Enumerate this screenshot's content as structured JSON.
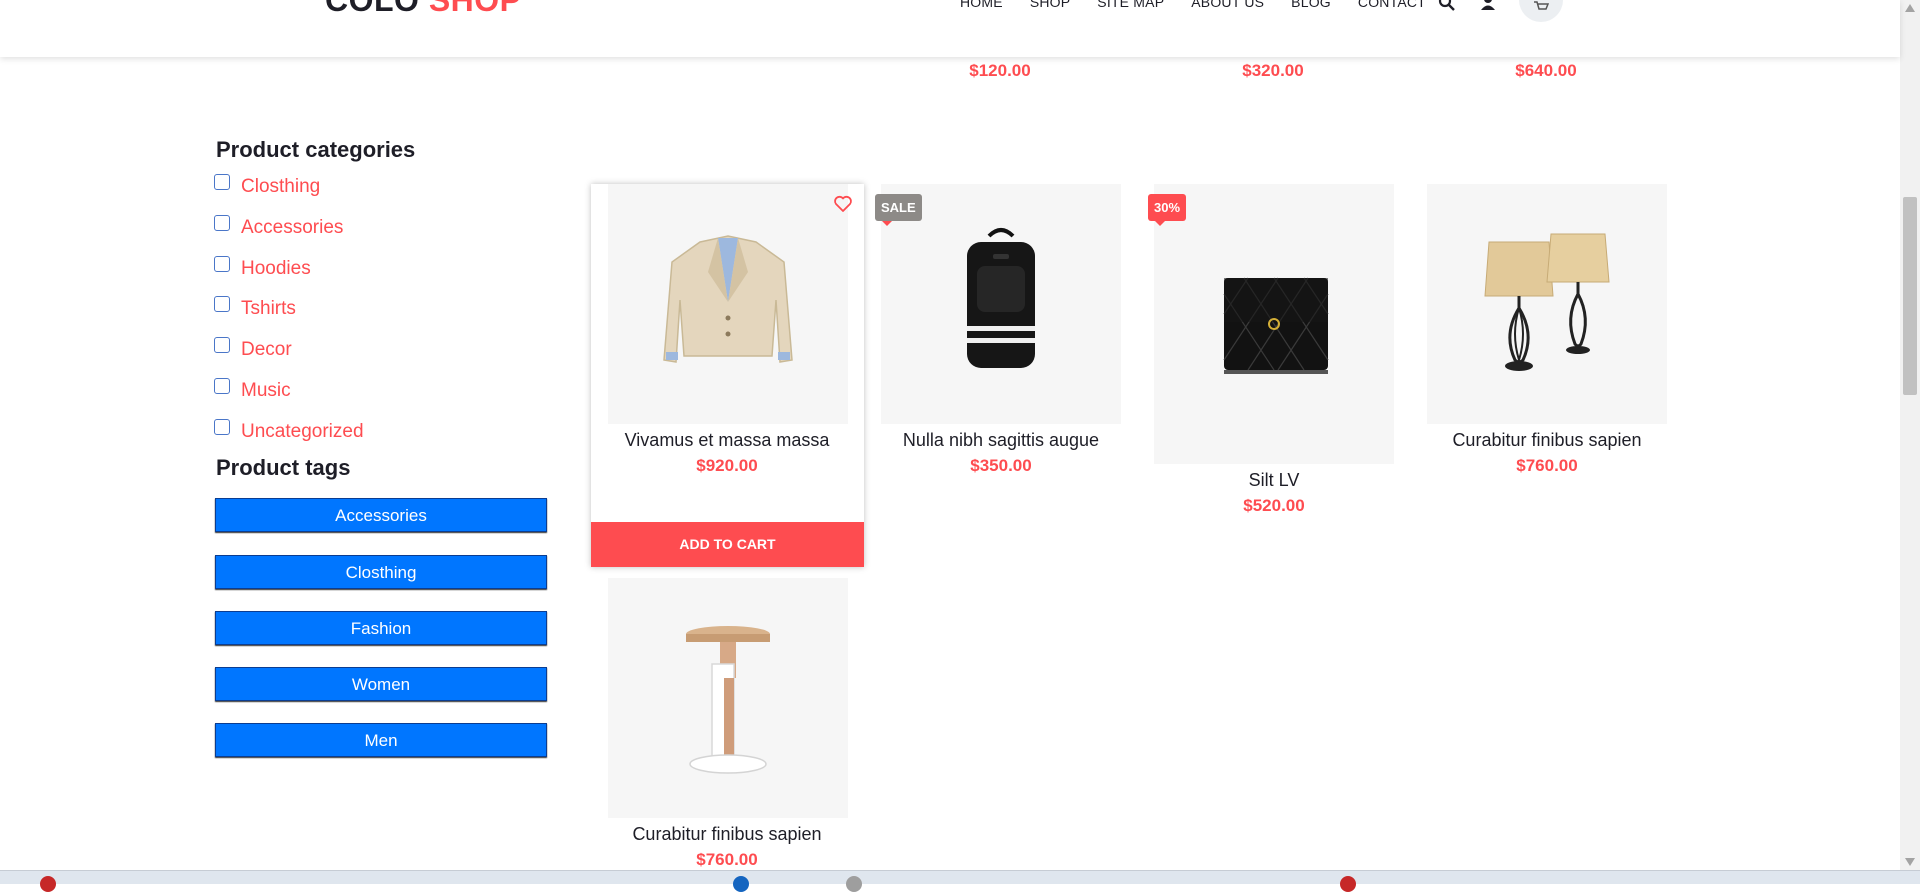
{
  "header": {
    "logo_main": "COLO",
    "logo_accent": "SHOP",
    "nav": [
      "HOME",
      "SHOP",
      "SITE MAP",
      "ABOUT US",
      "BLOG",
      "CONTACT"
    ]
  },
  "top_row_prices": [
    "$120.00",
    "$320.00",
    "$640.00"
  ],
  "sidebar": {
    "categories_title": "Product categories",
    "categories": [
      "Closthing",
      "Accessories",
      "Hoodies",
      "Tshirts",
      "Decor",
      "Music",
      "Uncategorized"
    ],
    "tags_title": "Product tags",
    "tags": [
      "Accessories",
      "Closthing",
      "Fashion",
      "Women",
      "Men"
    ]
  },
  "products": [
    {
      "name": "Vivamus et massa massa",
      "price": "$920.00",
      "image": "beige-blazer"
    },
    {
      "name": "Nulla nibh sagittis augue",
      "price": "$350.00",
      "image": "black-backpack",
      "badge": "SALE"
    },
    {
      "name": "Silt LV",
      "price": "$520.00",
      "image": "black-quilted-wallet",
      "badge": "30%"
    },
    {
      "name": "Curabitur finibus sapien",
      "price": "$760.00",
      "image": "table-lamps"
    },
    {
      "name": "Curabitur finibus sapien",
      "price": "$760.00",
      "image": "wooden-stool"
    }
  ],
  "add_to_cart_label": "ADD TO CART",
  "colors": {
    "accent": "#fe4c50",
    "tag_blue": "#0076ff",
    "text_dark": "#1e1e27"
  }
}
